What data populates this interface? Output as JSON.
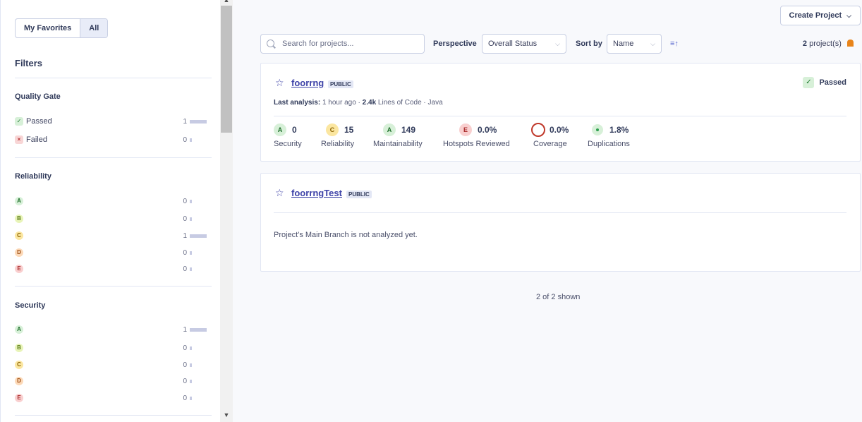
{
  "sidebar": {
    "toggle": {
      "favorites": "My Favorites",
      "all": "All"
    },
    "filters_title": "Filters",
    "quality_gate": {
      "title": "Quality Gate",
      "items": [
        {
          "label": "Passed",
          "count": "1",
          "bar": 1
        },
        {
          "label": "Failed",
          "count": "0",
          "bar": 0
        }
      ]
    },
    "reliability": {
      "title": "Reliability",
      "items": [
        {
          "grade": "A",
          "count": "0",
          "bar": 0
        },
        {
          "grade": "B",
          "count": "0",
          "bar": 0
        },
        {
          "grade": "C",
          "count": "1",
          "bar": 1
        },
        {
          "grade": "D",
          "count": "0",
          "bar": 0
        },
        {
          "grade": "E",
          "count": "0",
          "bar": 0
        }
      ]
    },
    "security": {
      "title": "Security",
      "items": [
        {
          "grade": "A",
          "count": "1",
          "bar": 1
        },
        {
          "grade": "B",
          "count": "0",
          "bar": 0
        },
        {
          "grade": "C",
          "count": "0",
          "bar": 0
        },
        {
          "grade": "D",
          "count": "0",
          "bar": 0
        },
        {
          "grade": "E",
          "count": "0",
          "bar": 0
        }
      ]
    }
  },
  "toolbar": {
    "create_project": "Create Project",
    "search_placeholder": "Search for projects...",
    "perspective_label": "Perspective",
    "perspective_value": "Overall Status",
    "sort_label": "Sort by",
    "sort_value": "Name",
    "sort_direction_icon": "sort-ascending-icon",
    "project_count_number": "2",
    "project_count_suffix": "project(s)"
  },
  "projects": [
    {
      "name": "foorrng",
      "visibility": "PUBLIC",
      "status": "Passed",
      "last_analysis_label": "Last analysis:",
      "last_analysis_value": "1 hour ago",
      "loc_value": "2.4k",
      "loc_label": "Lines of Code",
      "language": "Java",
      "metrics": [
        {
          "grade": "A",
          "value": "0",
          "label": "Security"
        },
        {
          "grade": "C",
          "value": "15",
          "label": "Reliability"
        },
        {
          "grade": "A",
          "value": "149",
          "label": "Maintainability"
        },
        {
          "grade": "E",
          "value": "0.0%",
          "label": "Hotspots Reviewed"
        },
        {
          "value": "0.0%",
          "label": "Coverage"
        },
        {
          "value": "1.8%",
          "label": "Duplications"
        }
      ]
    },
    {
      "name": "foorrngTest",
      "visibility": "PUBLIC",
      "message": "Project's Main Branch is not analyzed yet."
    }
  ],
  "footer": {
    "shown": "2 of 2 shown"
  },
  "colors": {
    "accent": "#3e43a8",
    "passed": "#217a31",
    "coverage_ring": "#c0392b"
  }
}
